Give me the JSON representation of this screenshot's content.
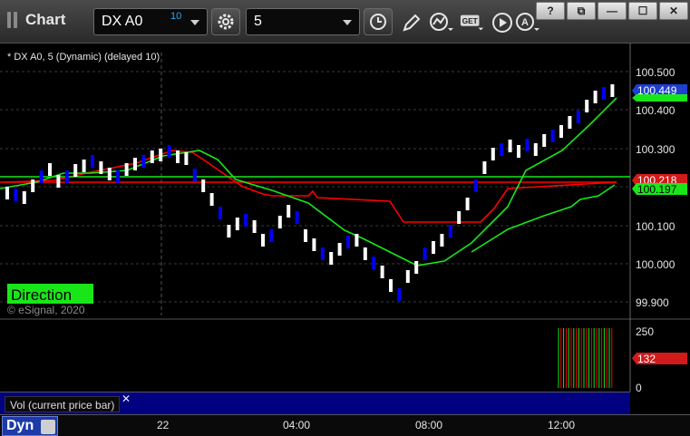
{
  "app": {
    "title": "Chart"
  },
  "toolbar": {
    "symbol": "DX A0",
    "symbol_badge": "10",
    "interval": "5",
    "icons": [
      "settings-gear-icon",
      "clock-icon",
      "pencil-icon",
      "study-icon",
      "get-icon",
      "play-icon",
      "a-icon"
    ]
  },
  "window_controls": [
    "?",
    "⧉",
    "—",
    "☐",
    "✕"
  ],
  "chart": {
    "header": "* DX A0, 5 (Dynamic) (delayed 10)",
    "direction_label": "Direction",
    "watermark": "© eSignal, 2020",
    "price_ticks": [
      "100.500",
      "100.400",
      "100.300",
      "100.100",
      "100.000",
      "99.900"
    ],
    "price_tags": [
      {
        "text": "100.449",
        "bg": "#1f3fd1",
        "fg": "#ffffff"
      },
      {
        "text": "100.218",
        "bg": "#d11a1a",
        "fg": "#ffffff"
      },
      {
        "text": "100.197",
        "bg": "#19e619",
        "fg": "#000000"
      }
    ],
    "volume": {
      "label": "Vol (current price bar)",
      "ticks": [
        "250",
        "0"
      ],
      "tag": {
        "text": "132",
        "bg": "#d11a1a",
        "fg": "#ffffff"
      }
    },
    "time_ticks": [
      "22",
      "04:00",
      "08:00",
      "12:00"
    ],
    "colors": {
      "up": "#ffffff",
      "down": "#0000ff",
      "red_line": "#ff0000",
      "green_line": "#19e619",
      "grid": "#3a3a3a"
    }
  },
  "bottom": {
    "mode": "Dyn"
  }
}
